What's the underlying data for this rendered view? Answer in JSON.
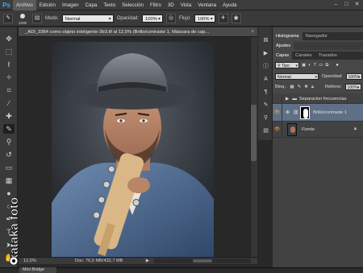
{
  "menubar": {
    "logo": "Ps",
    "items": [
      "Archivo",
      "Edición",
      "Imagen",
      "Capa",
      "Texto",
      "Selección",
      "Filtro",
      "3D",
      "Vista",
      "Ventana",
      "Ayuda"
    ],
    "window_controls": [
      "–",
      "□",
      "✕"
    ]
  },
  "options": {
    "brush_size": "1200",
    "mode_label": "Modo:",
    "mode_value": "Normal",
    "opacity_label": "Opacidad:",
    "opacity_value": "100%",
    "flow_label": "Flujo:",
    "flow_value": "100%"
  },
  "document": {
    "tab_title": "_ADI_3364 como objeto inteligente-3b3.tif al 12,5% (Brillo/contraste 1, Máscara de cap...",
    "close": "×",
    "zoom": "12,5%",
    "doc_size": "Doc: 76,5 MB/432,7 MB"
  },
  "panels": {
    "top_tabs": [
      "Histograma",
      "Navegador"
    ],
    "adjust_tab": "Ajustes",
    "layer_tabs": [
      "Capas",
      "Canales",
      "Trazados"
    ],
    "filter_type": "Tipo",
    "blend_mode": "Normal",
    "opacity_label": "Opacidad:",
    "opacity_value": "100%",
    "lock_label": "Bloq.:",
    "fill_label": "Relleno:",
    "fill_value": "100%",
    "layers": [
      {
        "name": "Separacion frecuencias",
        "kind": "group"
      },
      {
        "name": "Brillo/contraste 1",
        "kind": "adjustment"
      },
      {
        "name": "Fondo",
        "kind": "background"
      }
    ]
  },
  "bottom": {
    "mini_bridge": "Mini Bridge"
  },
  "watermark": {
    "text": "xataka foto"
  },
  "colors": {
    "accent_blue": "#31a8ff",
    "selected_layer": "#5f6f86",
    "eye_orange": "#f1a33f"
  }
}
